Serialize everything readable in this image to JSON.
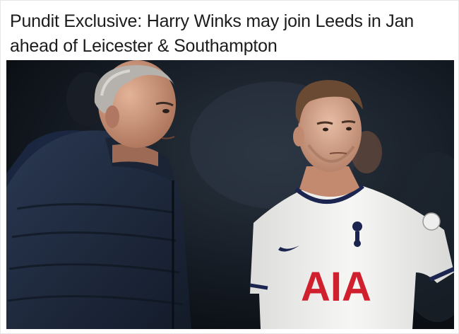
{
  "article": {
    "headline": "Pundit Exclusive: Harry Winks may join Leeds in Jan ahead of Leicester & Southampton"
  },
  "photo": {
    "shirt_sponsor": "AIA",
    "colors": {
      "background": "#111820",
      "jacket": "#1f2a3c",
      "shirt": "#f3f3f1",
      "sponsor": "#d0202e",
      "trim": "#1b2550"
    }
  }
}
